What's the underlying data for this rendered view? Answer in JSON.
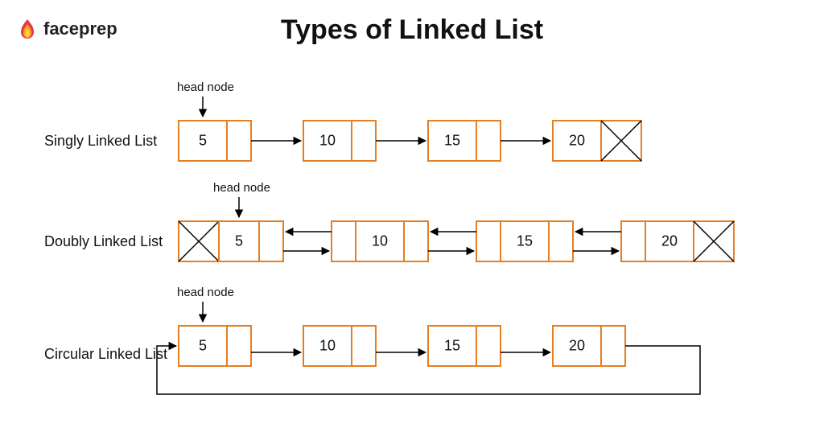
{
  "brand": "faceprep",
  "title": "Types of Linked List",
  "headLabel": "head node",
  "diagrams": {
    "singly": {
      "label": "Singly Linked List",
      "nodes": [
        "5",
        "10",
        "15",
        "20"
      ]
    },
    "doubly": {
      "label": "Doubly Linked List",
      "nodes": [
        "5",
        "10",
        "15",
        "20"
      ]
    },
    "circular": {
      "label": "Circular Linked List",
      "nodes": [
        "5",
        "10",
        "15",
        "20"
      ]
    }
  }
}
